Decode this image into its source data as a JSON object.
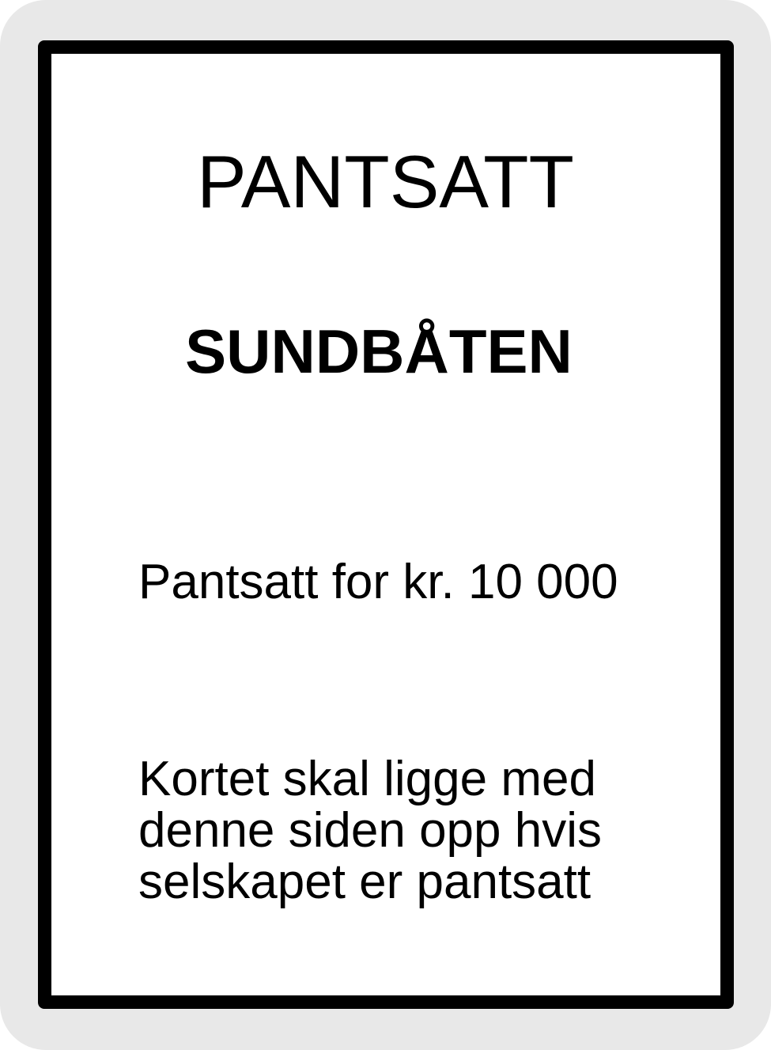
{
  "card": {
    "title": "PANTSATT",
    "property_name": "SUNDBÅTEN",
    "mortgage_text": "Pantsatt for kr. 10 000",
    "instruction_lines": [
      "Kortet skal ligge med",
      "denne siden opp hvis",
      "selskapet er pantsatt"
    ]
  },
  "colors": {
    "border": "#000000",
    "card_background": "#ffffff",
    "outer_background": "#e8e8e8"
  }
}
